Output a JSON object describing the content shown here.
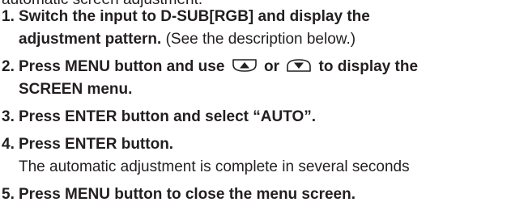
{
  "intro_cut": "automatic screen adjustment.",
  "steps": [
    {
      "number": "1.",
      "text_line1": "Switch the input to D-SUB[RGB] and display the",
      "text_line2": "adjustment pattern.",
      "note": " (See the description below.)"
    },
    {
      "number": "2.",
      "text_before": "Press MENU button and use ",
      "up_icon": "up-arrow-button-icon",
      "text_or": " or ",
      "down_icon": "down-arrow-button-icon",
      "text_after": " to display the",
      "text_line2": "SCREEN menu."
    },
    {
      "number": "3.",
      "text": "Press ENTER button and select “AUTO”."
    },
    {
      "number": "4.",
      "text": "Press ENTER button.",
      "sub_text": "The automatic adjustment is complete in several seconds"
    },
    {
      "number": "5.",
      "text": "Press MENU button to close the menu screen."
    }
  ]
}
